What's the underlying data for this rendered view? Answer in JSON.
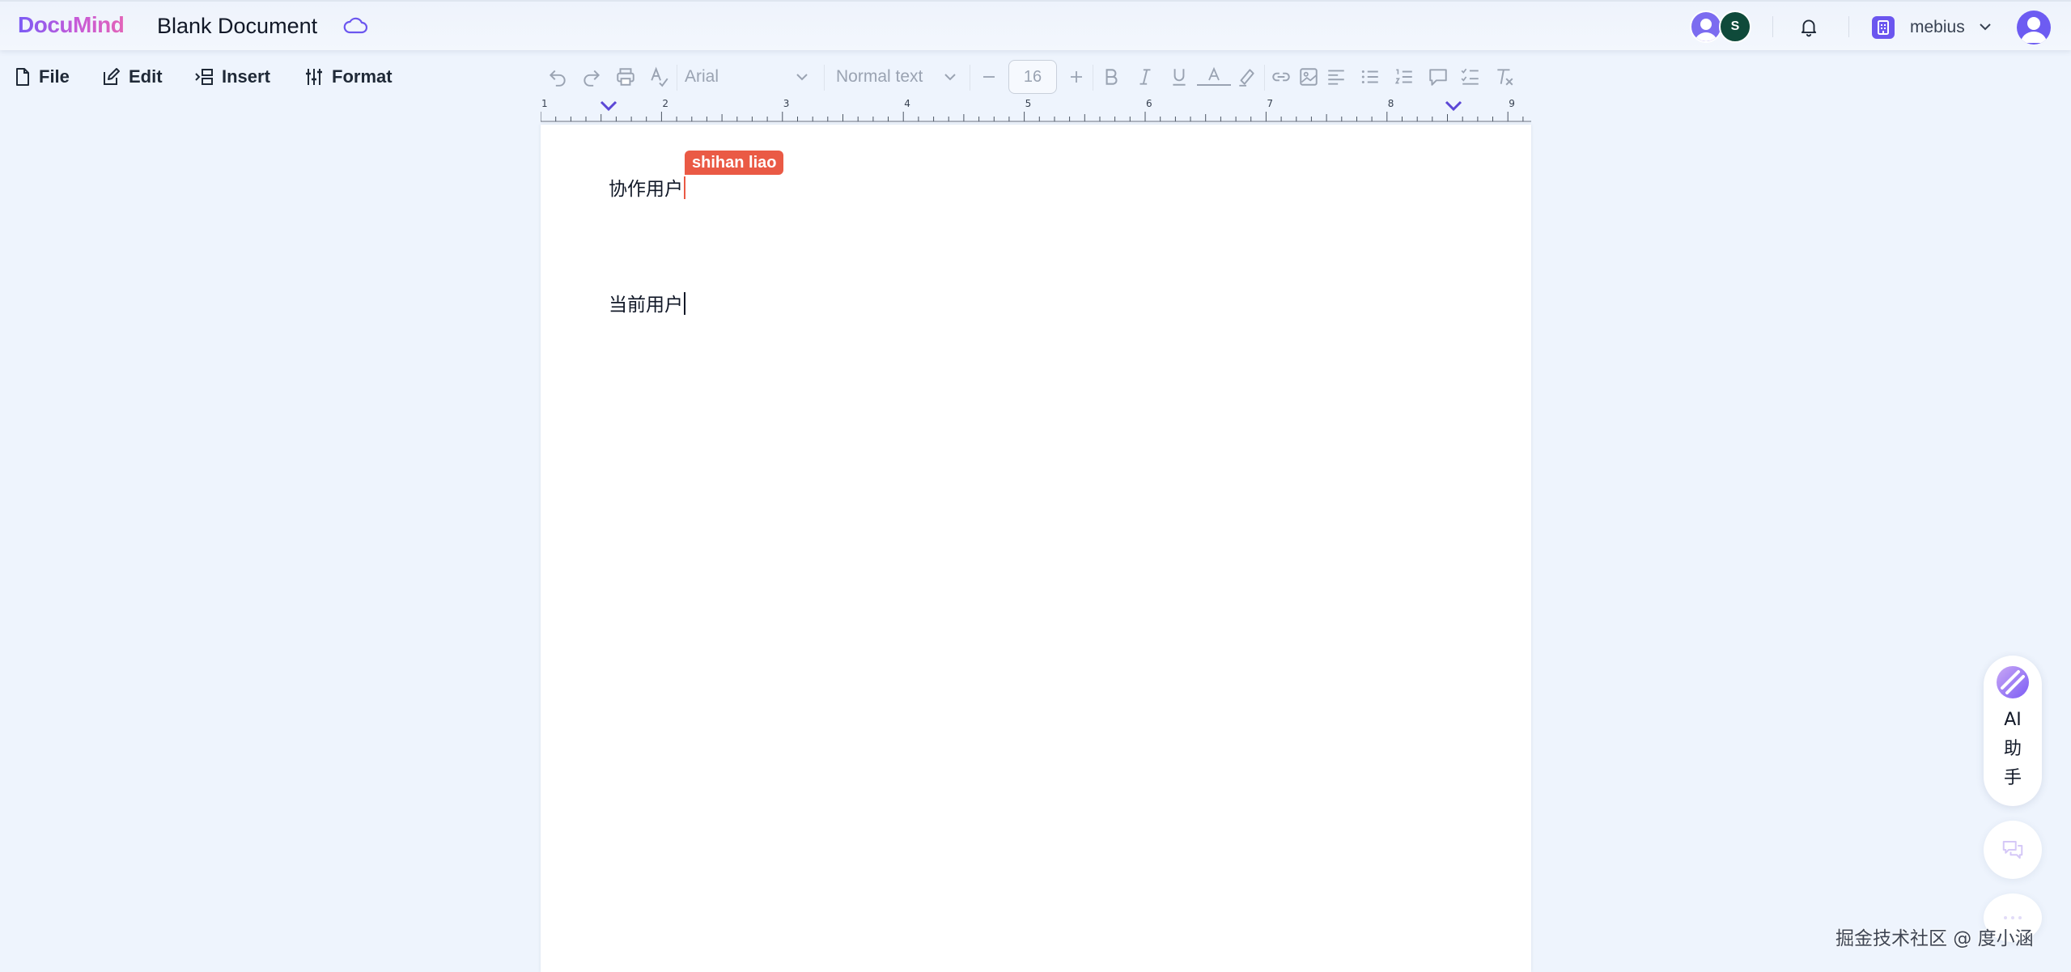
{
  "app": {
    "logo": "DocuMind",
    "doc_title": "Blank Document"
  },
  "header": {
    "collaborator_initial": "S",
    "workspace_name": "mebius"
  },
  "menu": {
    "file": "File",
    "edit": "Edit",
    "insert": "Insert",
    "format": "Format"
  },
  "toolbar": {
    "font_family": "Arial",
    "text_style": "Normal text",
    "font_size": "16",
    "icons": [
      "undo-icon",
      "redo-icon",
      "print-icon",
      "spellcheck-icon",
      "decrease-size-icon",
      "increase-size-icon",
      "bold-icon",
      "italic-icon",
      "underline-icon",
      "text-color-icon",
      "highlight-icon",
      "link-icon",
      "image-icon",
      "align-icon",
      "bullet-list-icon",
      "numbered-list-icon",
      "comment-icon",
      "checklist-icon",
      "clear-format-icon"
    ]
  },
  "ruler": {
    "labels": [
      "1",
      "2",
      "3",
      "4",
      "5",
      "6",
      "7",
      "8",
      "9"
    ]
  },
  "document": {
    "paragraphs": [
      {
        "text": "协作用户",
        "caret_color": "#ea5a45"
      },
      {
        "text": "当前用户",
        "caret_color": "#111827"
      }
    ],
    "remote_cursor_label": "shihan liao",
    "remote_cursor_color": "#ea5a45"
  },
  "assistant": {
    "label_ai": "AI",
    "label_line2": "助",
    "label_line3": "手"
  },
  "watermark": "掘金技术社区 @ 度小涵",
  "colors": {
    "accent": "#6b56ef",
    "background": "#eef4fd",
    "remote_user": "#ea5a45"
  }
}
